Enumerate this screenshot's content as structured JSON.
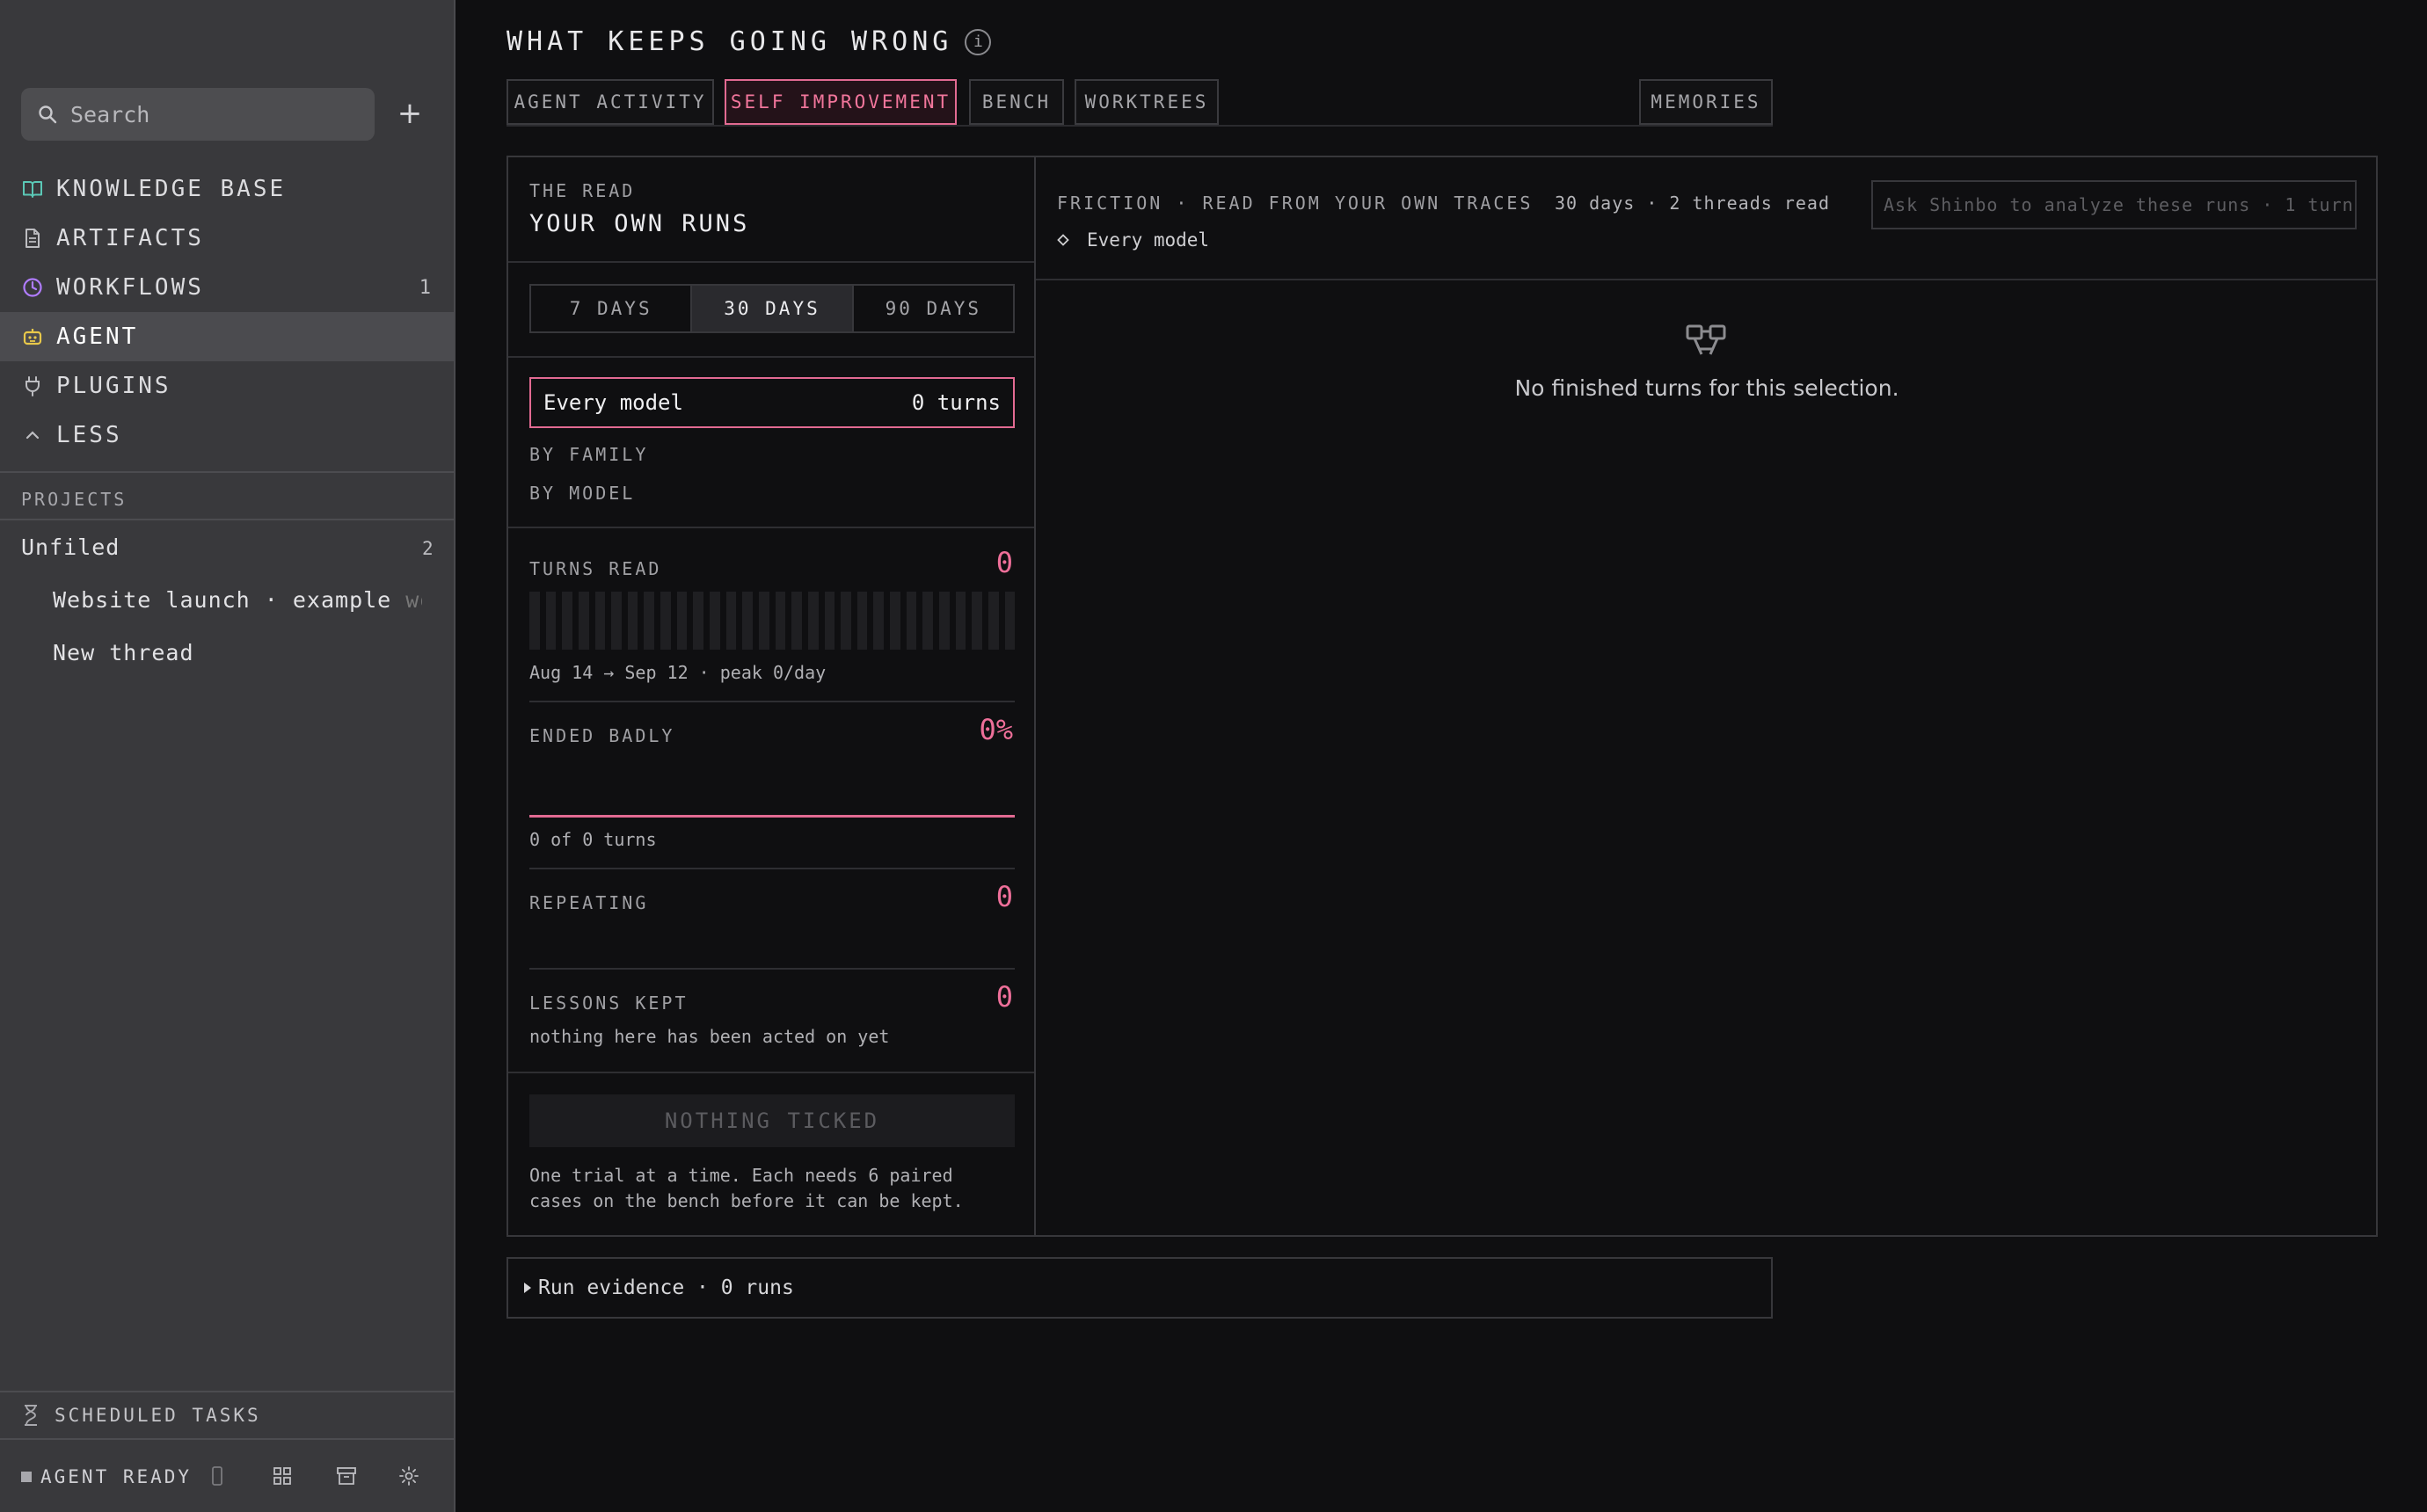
{
  "sidebar": {
    "search": {
      "placeholder": "Search"
    },
    "new_label": "+",
    "nav": [
      {
        "label": "KNOWLEDGE BASE",
        "icon": "book-icon",
        "color": "#5bc8b6"
      },
      {
        "label": "ARTIFACTS",
        "icon": "document-icon",
        "color": "#bdbdc1"
      },
      {
        "label": "WORKFLOWS",
        "icon": "clock-icon",
        "color": "#b07cff",
        "count": "1"
      },
      {
        "label": "AGENT",
        "icon": "robot-icon",
        "color": "#e8c84a"
      },
      {
        "label": "PLUGINS",
        "icon": "plug-icon",
        "color": "#bdbdc1"
      },
      {
        "label": "LESS",
        "icon": "chevron-up-icon",
        "color": "#bdbdc1"
      }
    ],
    "projects_label": "PROJECTS",
    "unfiled": {
      "label": "Unfiled",
      "count": "2"
    },
    "threads": [
      {
        "title": "Website launch · example ",
        "title_fade": "wo"
      },
      {
        "title": "New thread"
      }
    ],
    "scheduled_label": "SCHEDULED TASKS",
    "status": "AGENT READY"
  },
  "main": {
    "title": "WHAT KEEPS GOING WRONG",
    "info_glyph": "i",
    "tabs": [
      "AGENT ACTIVITY",
      "SELF IMPROVEMENT",
      "BENCH",
      "WORKTREES",
      "MEMORIES"
    ],
    "active_tab": "SELF IMPROVEMENT",
    "accent": "#ee6f99"
  },
  "read": {
    "kicker": "THE READ",
    "title": "YOUR OWN RUNS",
    "ranges": [
      "7 DAYS",
      "30 DAYS",
      "90 DAYS"
    ],
    "active_range": "30 DAYS",
    "model_selector": {
      "label": "Every model",
      "value": "0 turns"
    },
    "by_family": "BY FAMILY",
    "by_model": "BY MODEL",
    "turns_read": {
      "label": "TURNS READ",
      "value": "0",
      "caption": "Aug 14 → Sep 12 · peak 0/day",
      "daily": [
        0,
        0,
        0,
        0,
        0,
        0,
        0,
        0,
        0,
        0,
        0,
        0,
        0,
        0,
        0,
        0,
        0,
        0,
        0,
        0,
        0,
        0,
        0,
        0,
        0,
        0,
        0,
        0,
        0,
        0
      ]
    },
    "ended_badly": {
      "label": "ENDED BADLY",
      "value": "0%",
      "caption": "0 of 0 turns"
    },
    "repeating": {
      "label": "REPEATING",
      "value": "0"
    },
    "lessons_kept": {
      "label": "LESSONS KEPT",
      "value": "0",
      "caption": "nothing here has been acted on yet"
    },
    "action_button": "NOTHING TICKED",
    "footnote_1": "One trial at a time. Each needs 6 paired",
    "footnote_2": "cases on the bench before it can be kept."
  },
  "friction": {
    "title": "FRICTION · READ FROM YOUR OWN TRACES",
    "meta": "30 days · 2 threads read",
    "ask_placeholder": "Ask Shinbo to analyze these runs · 1 turn",
    "filter": "Every model",
    "empty_text": "No finished turns for this selection."
  },
  "evidence": {
    "label": "Run evidence · 0 runs"
  }
}
